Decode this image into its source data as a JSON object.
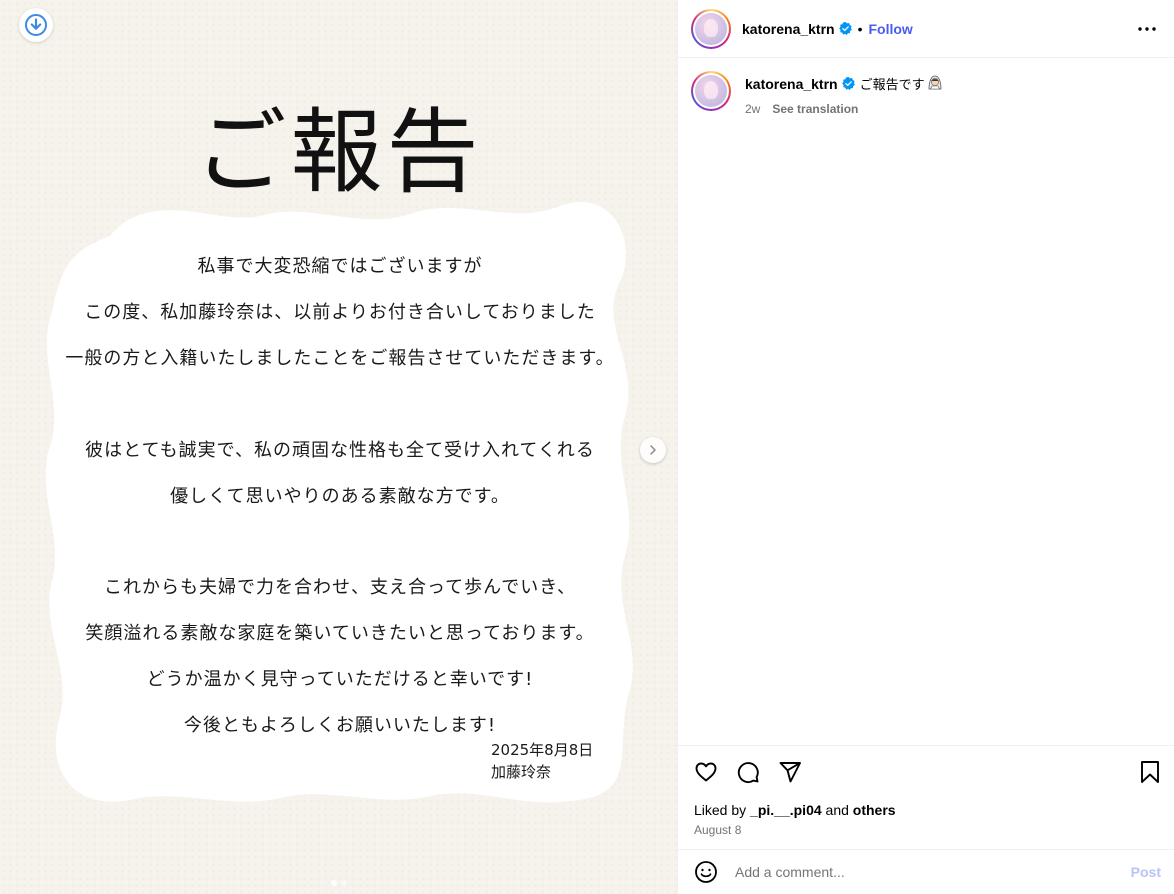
{
  "post_image": {
    "title": "ご報告",
    "paragraphs": [
      "私事で大変恐縮ではございますが",
      "この度、私加藤玲奈は、以前よりお付き合いしておりました",
      "一般の方と入籍いたしましたことをご報告させていただきます。",
      "彼はとても誠実で、私の頑固な性格も全て受け入れてくれる",
      "優しくて思いやりのある素敵な方です。",
      "これからも夫婦で力を合わせ、支え合って歩んでいき、",
      "笑顔溢れる素敵な家庭を築いていきたいと思っております。",
      "どうか温かく見守っていただけると幸いです!",
      "今後ともよろしくお願いいたします!"
    ],
    "signature_date": "2025年8月8日",
    "signature_name": "加藤玲奈",
    "carousel": {
      "count": 2,
      "active_index": 0
    }
  },
  "header": {
    "username": "katorena_ktrn",
    "separator": "•",
    "follow_label": "Follow"
  },
  "caption": {
    "username": "katorena_ktrn",
    "text": "ご報告です",
    "emoji": "bride-emoji",
    "age": "2w",
    "see_translation": "See translation"
  },
  "engagement": {
    "liked_prefix": "Liked by",
    "liked_user": "_pi.__.pi04",
    "liked_joiner": "and",
    "liked_suffix": "others",
    "date": "August 8"
  },
  "comment": {
    "placeholder": "Add a comment...",
    "post_label": "Post"
  },
  "colors": {
    "follow": "#4a5cf0",
    "verified": "#0095f6",
    "muted": "#737373",
    "post_disabled": "#b8c4f5",
    "media_bg": "#f6f2ec"
  }
}
